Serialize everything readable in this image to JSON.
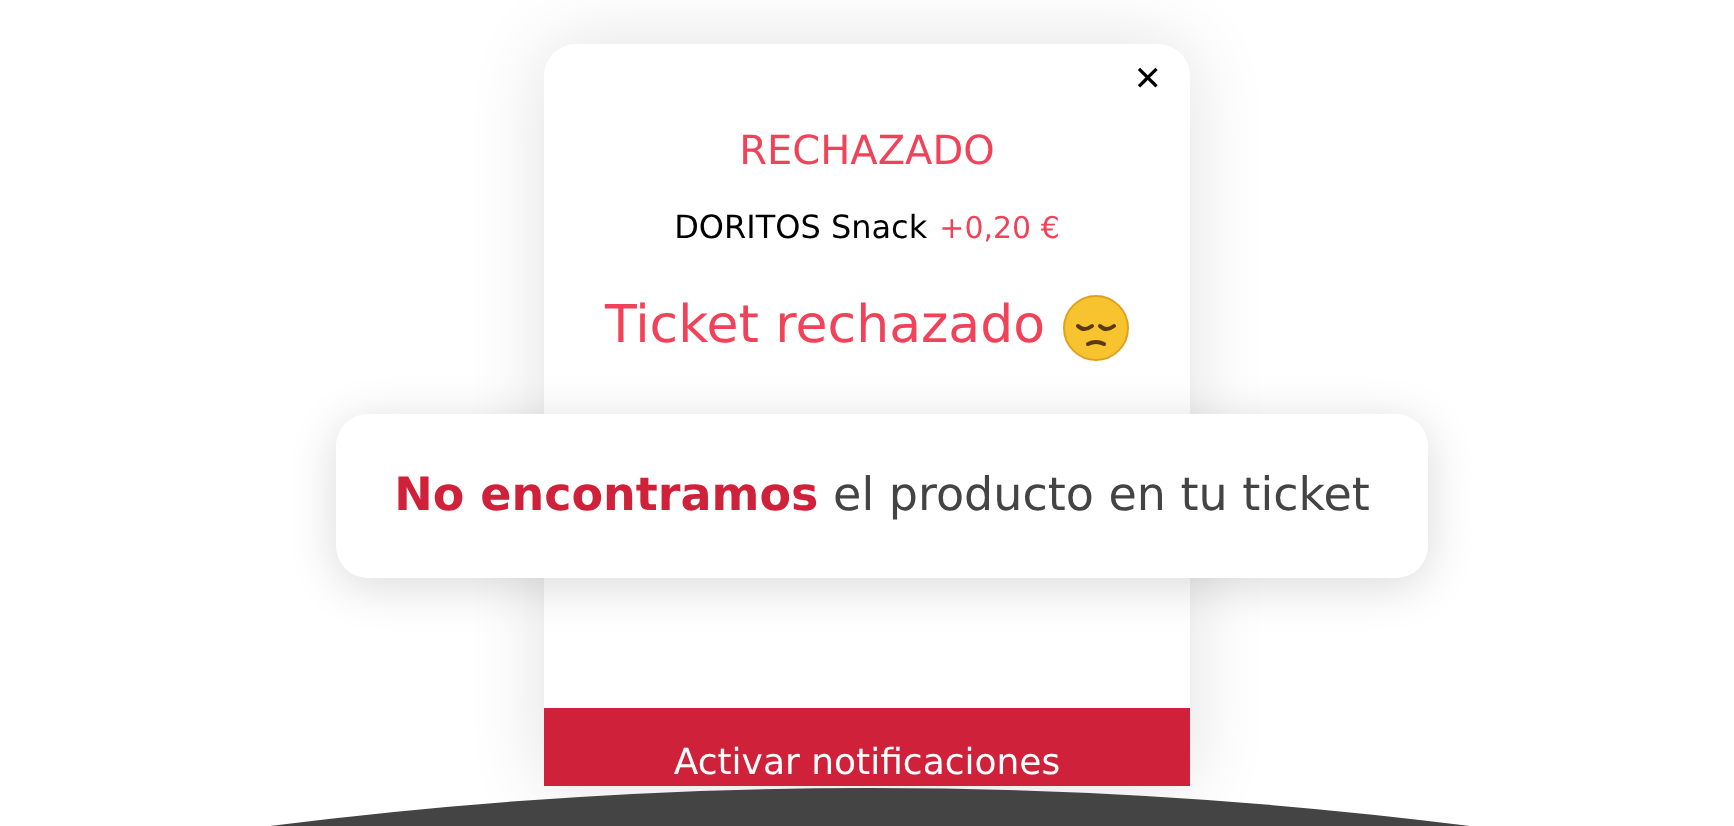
{
  "modal": {
    "close": "✕",
    "status": "RECHAZADO",
    "product": "DORITOS Snack",
    "amount": "+0,20 €",
    "message": "Ticket rechazado",
    "button": "Activar notificaciones"
  },
  "toast": {
    "text": "**No encontramos** el producto en tu ticket"
  }
}
